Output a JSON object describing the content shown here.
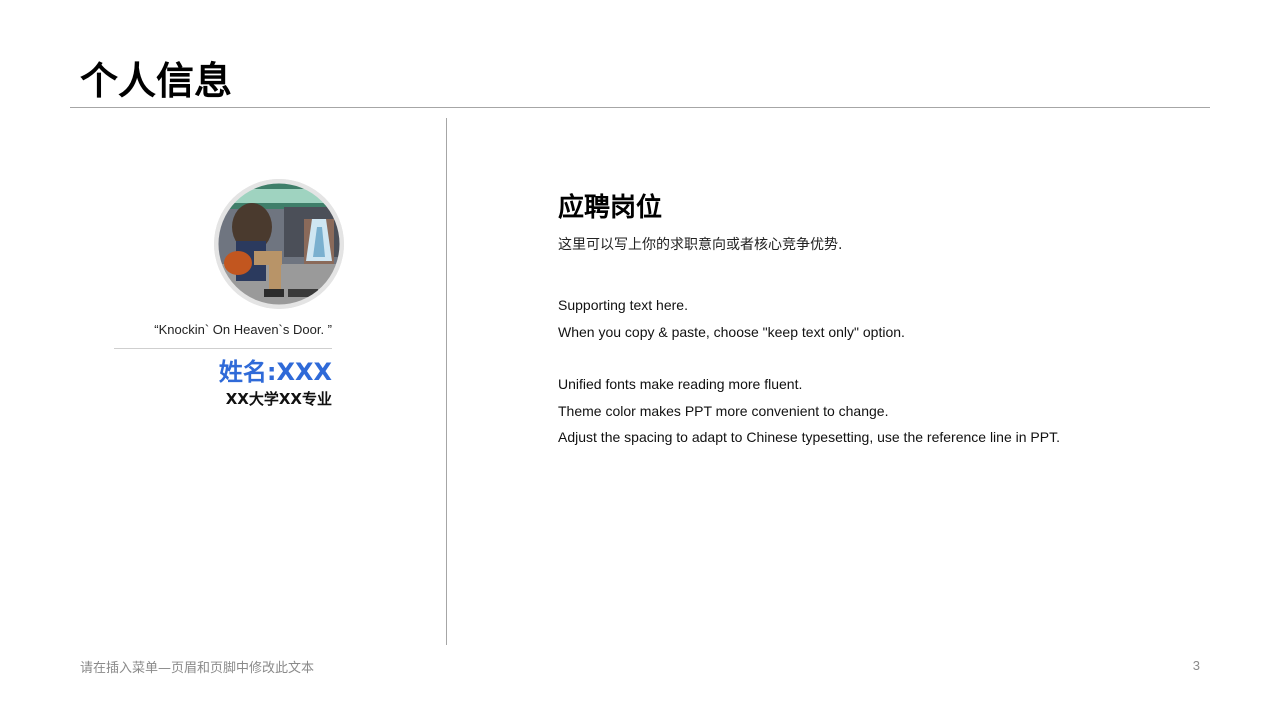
{
  "title": "个人信息",
  "profile": {
    "quote": "“Knockin` On Heaven`s Door. ”",
    "name": "姓名:XXX",
    "major": "XX大学XX专业"
  },
  "job": {
    "heading": "应聘岗位",
    "description": "这里可以写上你的求职意向或者核心竞争优势."
  },
  "supporting": {
    "line1": "Supporting text here.",
    "line2": "When you copy & paste, choose \"keep text only\" option."
  },
  "notes": {
    "line1": "Unified fonts make reading more fluent.",
    "line2": "Theme color makes PPT more convenient to change.",
    "line3": "Adjust the spacing to adapt to Chinese typesetting, use the reference line in PPT."
  },
  "footer": {
    "text": "请在插入菜单—页眉和页脚中修改此文本",
    "page_number": "3"
  },
  "colors": {
    "accent_blue": "#2f6ad8",
    "rule_gray": "#a6a6a6",
    "footer_gray": "#8a8a8a"
  }
}
